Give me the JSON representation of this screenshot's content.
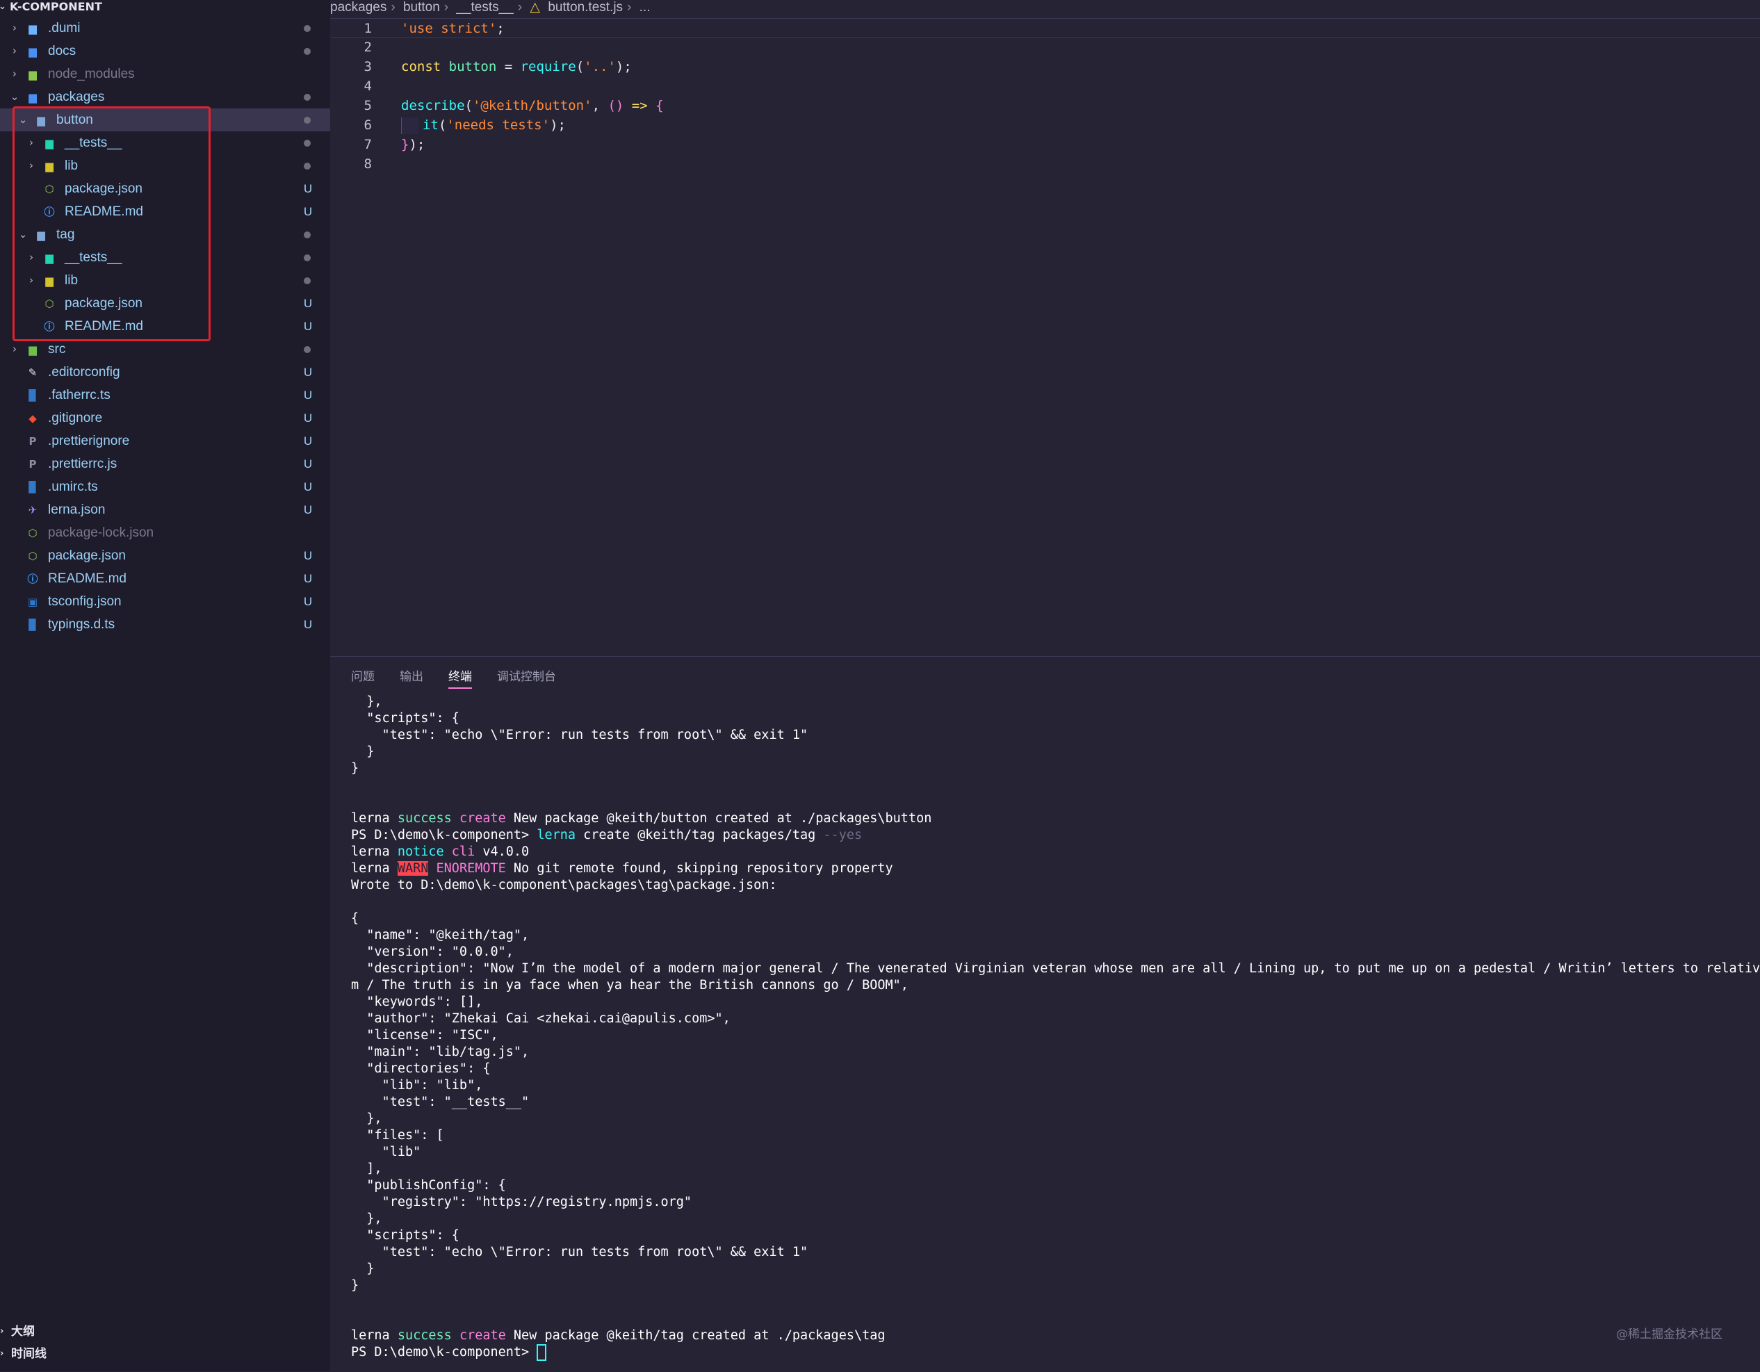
{
  "sidebar": {
    "header": "K-COMPONENT",
    "items": [
      {
        "label": ".dumi",
        "kind": "folder",
        "icon": "folder-settings-icon",
        "expanded": false,
        "indent": 0,
        "status": "dot",
        "color": "#9ad0f5"
      },
      {
        "label": "docs",
        "kind": "folder",
        "icon": "folder-docs-icon",
        "expanded": false,
        "indent": 0,
        "status": "dot",
        "color": "#9ad0f5"
      },
      {
        "label": "node_modules",
        "kind": "folder",
        "icon": "folder-node-icon",
        "expanded": false,
        "indent": 0,
        "status": "",
        "color": "#7a788c"
      },
      {
        "label": "packages",
        "kind": "folder",
        "icon": "folder-packages-icon",
        "expanded": true,
        "indent": 0,
        "status": "dot",
        "color": "#9ad0f5"
      },
      {
        "label": "button",
        "kind": "folder",
        "icon": "folder-open-icon",
        "expanded": true,
        "indent": 1,
        "status": "dot",
        "color": "#9ad0f5",
        "selected": true
      },
      {
        "label": "__tests__",
        "kind": "folder",
        "icon": "folder-test-icon",
        "expanded": false,
        "indent": 2,
        "status": "dot",
        "color": "#9ad0f5"
      },
      {
        "label": "lib",
        "kind": "folder",
        "icon": "folder-lib-icon",
        "expanded": false,
        "indent": 2,
        "status": "dot",
        "color": "#9ad0f5"
      },
      {
        "label": "package.json",
        "kind": "file",
        "icon": "nodejs-icon",
        "indent": 2,
        "status": "U",
        "color": "#9ad0f5"
      },
      {
        "label": "README.md",
        "kind": "file",
        "icon": "info-icon",
        "indent": 2,
        "status": "U",
        "color": "#9ad0f5"
      },
      {
        "label": "tag",
        "kind": "folder",
        "icon": "folder-open-icon",
        "expanded": true,
        "indent": 1,
        "status": "dot",
        "color": "#9ad0f5"
      },
      {
        "label": "__tests__",
        "kind": "folder",
        "icon": "folder-test-icon",
        "expanded": false,
        "indent": 2,
        "status": "dot",
        "color": "#9ad0f5"
      },
      {
        "label": "lib",
        "kind": "folder",
        "icon": "folder-lib-icon",
        "expanded": false,
        "indent": 2,
        "status": "dot",
        "color": "#9ad0f5"
      },
      {
        "label": "package.json",
        "kind": "file",
        "icon": "nodejs-icon",
        "indent": 2,
        "status": "U",
        "color": "#9ad0f5"
      },
      {
        "label": "README.md",
        "kind": "file",
        "icon": "info-icon",
        "indent": 2,
        "status": "U",
        "color": "#9ad0f5"
      },
      {
        "label": "src",
        "kind": "folder",
        "icon": "folder-src-icon",
        "expanded": false,
        "indent": 0,
        "status": "dot",
        "color": "#9ad0f5"
      },
      {
        "label": ".editorconfig",
        "kind": "file",
        "icon": "editorconfig-icon",
        "indent": 0,
        "status": "U",
        "color": "#9ad0f5"
      },
      {
        "label": ".fatherrc.ts",
        "kind": "file",
        "icon": "typescript-icon",
        "indent": 0,
        "status": "U",
        "color": "#9ad0f5"
      },
      {
        "label": ".gitignore",
        "kind": "file",
        "icon": "git-icon",
        "indent": 0,
        "status": "U",
        "color": "#9ad0f5"
      },
      {
        "label": ".prettierignore",
        "kind": "file",
        "icon": "prettier-icon",
        "indent": 0,
        "status": "U",
        "color": "#9ad0f5"
      },
      {
        "label": ".prettierrc.js",
        "kind": "file",
        "icon": "prettier-icon",
        "indent": 0,
        "status": "U",
        "color": "#9ad0f5"
      },
      {
        "label": ".umirc.ts",
        "kind": "file",
        "icon": "typescript-icon",
        "indent": 0,
        "status": "U",
        "color": "#9ad0f5"
      },
      {
        "label": "lerna.json",
        "kind": "file",
        "icon": "lerna-icon",
        "indent": 0,
        "status": "U",
        "color": "#9ad0f5"
      },
      {
        "label": "package-lock.json",
        "kind": "file",
        "icon": "nodejs-icon",
        "indent": 0,
        "status": "",
        "color": "#7a788c"
      },
      {
        "label": "package.json",
        "kind": "file",
        "icon": "nodejs-icon",
        "indent": 0,
        "status": "U",
        "color": "#9ad0f5"
      },
      {
        "label": "README.md",
        "kind": "file",
        "icon": "info-icon",
        "indent": 0,
        "status": "U",
        "color": "#9ad0f5"
      },
      {
        "label": "tsconfig.json",
        "kind": "file",
        "icon": "tsconfig-icon",
        "indent": 0,
        "status": "U",
        "color": "#9ad0f5"
      },
      {
        "label": "typings.d.ts",
        "kind": "file",
        "icon": "typescript-def-icon",
        "indent": 0,
        "status": "U",
        "color": "#9ad0f5"
      }
    ],
    "outline_label": "大纲",
    "timeline_label": "时间线"
  },
  "breadcrumb": [
    "packages",
    "button",
    "__tests__",
    "button.test.js",
    "..."
  ],
  "editor": {
    "lines": [
      {
        "n": "1",
        "tokens": [
          [
            "str",
            "'use strict'"
          ],
          [
            "punc",
            ";"
          ]
        ],
        "current": true
      },
      {
        "n": "2",
        "tokens": []
      },
      {
        "n": "3",
        "tokens": [
          [
            "kw",
            "const "
          ],
          [
            "var",
            "button "
          ],
          [
            "punc",
            "= "
          ],
          [
            "fn",
            "require"
          ],
          [
            "punc",
            "("
          ],
          [
            "str",
            "'..'"
          ],
          [
            "punc",
            ");"
          ]
        ]
      },
      {
        "n": "4",
        "tokens": []
      },
      {
        "n": "5",
        "tokens": [
          [
            "fn",
            "describe"
          ],
          [
            "punc",
            "("
          ],
          [
            "str",
            "'@keith/button'"
          ],
          [
            "punc",
            ", "
          ],
          [
            "brace",
            "() "
          ],
          [
            "kw",
            "=> "
          ],
          [
            "brace",
            "{"
          ]
        ]
      },
      {
        "n": "6",
        "tokens": [
          [
            "guide",
            ""
          ],
          [
            "fn",
            "it"
          ],
          [
            "punc",
            "("
          ],
          [
            "str",
            "'needs tests'"
          ],
          [
            "punc",
            ");"
          ]
        ]
      },
      {
        "n": "7",
        "tokens": [
          [
            "brace",
            "}"
          ],
          [
            "punc",
            ");"
          ]
        ]
      },
      {
        "n": "8",
        "tokens": []
      }
    ]
  },
  "panel": {
    "tabs": [
      "问题",
      "输出",
      "终端",
      "调试控制台"
    ],
    "active_tab": "终端"
  },
  "terminal": {
    "lines": [
      [
        [
          "w",
          "  },"
        ]
      ],
      [
        [
          "w",
          "  \"scripts\": {"
        ]
      ],
      [
        [
          "w",
          "    \"test\": \"echo \\\"Error: run tests from root\\\" && exit 1\""
        ]
      ],
      [
        [
          "w",
          "  }"
        ]
      ],
      [
        [
          "w",
          "}"
        ]
      ],
      [
        [
          "w",
          ""
        ]
      ],
      [
        [
          "w",
          ""
        ]
      ],
      [
        [
          "w",
          "lerna "
        ],
        [
          "green",
          "success "
        ],
        [
          "pink",
          "create "
        ],
        [
          "w",
          "New package @keith/button created at ./packages\\button"
        ]
      ],
      [
        [
          "w",
          "PS D:\\demo\\k-component> "
        ],
        [
          "cyan",
          "lerna "
        ],
        [
          "w",
          "create @keith/tag packages/tag "
        ],
        [
          "dim",
          "--yes"
        ]
      ],
      [
        [
          "w",
          "lerna "
        ],
        [
          "cyan",
          "notice "
        ],
        [
          "pink",
          "cli "
        ],
        [
          "w",
          "v4.0.0"
        ]
      ],
      [
        [
          "w",
          "lerna "
        ],
        [
          "warnbg",
          "WARN"
        ],
        [
          "w",
          " "
        ],
        [
          "pink",
          "ENOREMOTE "
        ],
        [
          "w",
          "No git remote found, skipping repository property"
        ]
      ],
      [
        [
          "w",
          "Wrote to D:\\demo\\k-component\\packages\\tag\\package.json:"
        ]
      ],
      [
        [
          "w",
          ""
        ]
      ],
      [
        [
          "w",
          "{"
        ]
      ],
      [
        [
          "w",
          "  \"name\": \"@keith/tag\","
        ]
      ],
      [
        [
          "w",
          "  \"version\": \"0.0.0\","
        ]
      ],
      [
        [
          "w",
          "  \"description\": \"Now I’m the model of a modern major general / The venerated Virginian veteran whose men are all / Lining up, to put me up on a pedestal / Writin’ letters to relatives"
        ]
      ],
      [
        [
          "w",
          "m / The truth is in ya face when ya hear the British cannons go / BOOM\","
        ]
      ],
      [
        [
          "w",
          "  \"keywords\": [],"
        ]
      ],
      [
        [
          "w",
          "  \"author\": \"Zhekai Cai <zhekai.cai@apulis.com>\","
        ]
      ],
      [
        [
          "w",
          "  \"license\": \"ISC\","
        ]
      ],
      [
        [
          "w",
          "  \"main\": \"lib/tag.js\","
        ]
      ],
      [
        [
          "w",
          "  \"directories\": {"
        ]
      ],
      [
        [
          "w",
          "    \"lib\": \"lib\","
        ]
      ],
      [
        [
          "w",
          "    \"test\": \"__tests__\""
        ]
      ],
      [
        [
          "w",
          "  },"
        ]
      ],
      [
        [
          "w",
          "  \"files\": ["
        ]
      ],
      [
        [
          "w",
          "    \"lib\""
        ]
      ],
      [
        [
          "w",
          "  ],"
        ]
      ],
      [
        [
          "w",
          "  \"publishConfig\": {"
        ]
      ],
      [
        [
          "w",
          "    \"registry\": \"https://registry.npmjs.org\""
        ]
      ],
      [
        [
          "w",
          "  },"
        ]
      ],
      [
        [
          "w",
          "  \"scripts\": {"
        ]
      ],
      [
        [
          "w",
          "    \"test\": \"echo \\\"Error: run tests from root\\\" && exit 1\""
        ]
      ],
      [
        [
          "w",
          "  }"
        ]
      ],
      [
        [
          "w",
          "}"
        ]
      ],
      [
        [
          "w",
          ""
        ]
      ],
      [
        [
          "w",
          ""
        ]
      ],
      [
        [
          "w",
          "lerna "
        ],
        [
          "green",
          "success "
        ],
        [
          "pink",
          "create "
        ],
        [
          "w",
          "New package @keith/tag created at ./packages\\tag"
        ]
      ],
      [
        [
          "w",
          "PS D:\\demo\\k-component> "
        ],
        [
          "cursor",
          ""
        ]
      ]
    ]
  },
  "watermark": "@稀土掘金技术社区",
  "colors": {
    "accent": "#ff7edb",
    "highlight_border": "#e5202e",
    "status_untracked": "#9ad0f5",
    "ignored": "#7a788c"
  }
}
